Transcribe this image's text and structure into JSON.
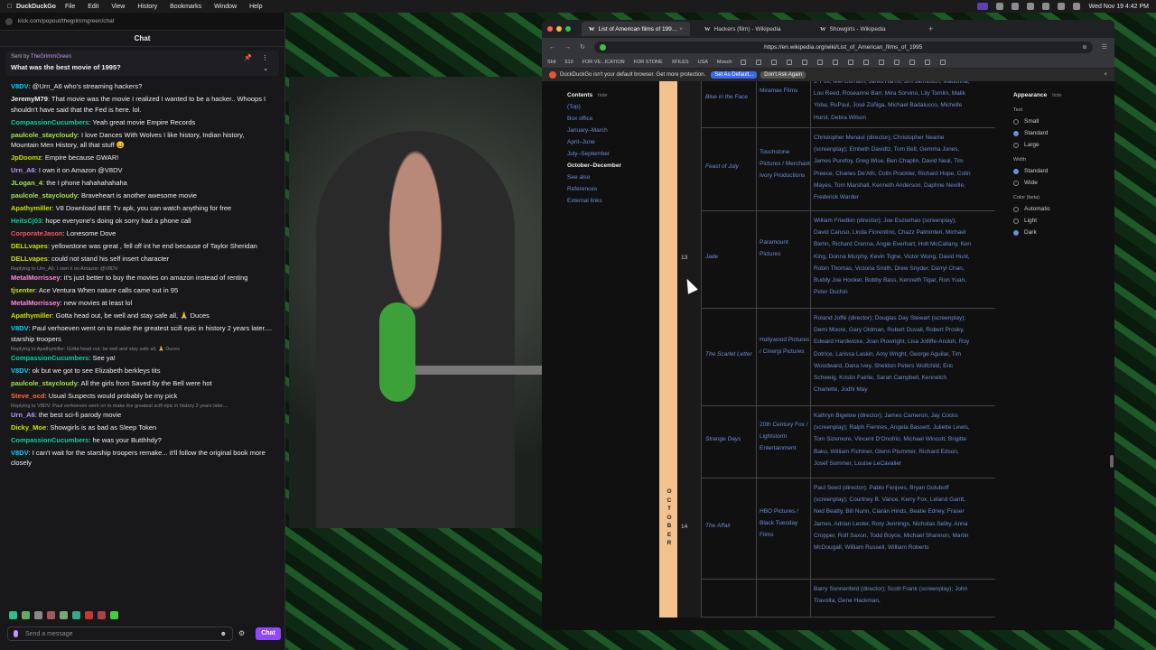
{
  "menubar": {
    "app": "DuckDuckGo",
    "items": [
      "File",
      "Edit",
      "View",
      "History",
      "Bookmarks",
      "Window",
      "Help"
    ],
    "clock": "Wed Nov 19 4:42 PM"
  },
  "chat": {
    "url": "kick.com/popout/thegrimmgreen/chat",
    "title": "Chat",
    "pinned": {
      "sent_prefix": "Sent by",
      "sent_by": "TheGrimmGreen",
      "question": "What was the best movie of 1995?"
    },
    "messages": [
      {
        "user": "V8DV",
        "color": "#00d4ff",
        "text": "@Urn_A6 who's streaming hackers?"
      },
      {
        "user": "JeremyM79",
        "color": "#efeff1",
        "text": "That movie was the movie I realized I wanted to be a hacker.. Whoops I shouldn't have said that the Fed is here. lol."
      },
      {
        "user": "CompassionCucumbers",
        "color": "#00d4a0",
        "text": "Yeah great movie Empire Records"
      },
      {
        "user": "paulcole_staycloudy",
        "color": "#a0e050",
        "text": "I love Dances With Wolves I like history, Indian history, Mountain Men History, all that stuff 😀"
      },
      {
        "user": "JpDoomz",
        "color": "#c8e000",
        "text": "Empire because GWAR!"
      },
      {
        "user": "Urn_A6",
        "color": "#bf94ff",
        "text": "I own it on Amazon @V8DV"
      },
      {
        "user": "JLogan_4",
        "color": "#a0e050",
        "text": "the I phone hahahahahaha"
      },
      {
        "user": "paulcole_staycloudy",
        "color": "#a0e050",
        "text": "Braveheart is another awesome movie"
      },
      {
        "user": "Apathymiller",
        "color": "#c8e000",
        "text": "V8 Download BEE Tv apk, you can watch anything for free"
      },
      {
        "user": "HeitsCj03",
        "color": "#00d4a0",
        "text": "hope everyone's doing ok sorry had a phone call"
      },
      {
        "user": "CorporateJason",
        "color": "#ff4f6a",
        "text": "Lonesome Dove"
      },
      {
        "user": "DELLvapes",
        "color": "#c8e000",
        "text": "yellowstone was great , fell off int he end because of Taylor Sheridan"
      },
      {
        "user": "DELLvapes",
        "color": "#c8e000",
        "text": "could not stand his self insert character"
      },
      {
        "user": "MetalMorrissey",
        "color": "#ff8ad8",
        "reply": "Replying to Urn_A6: I own it on Amazon @V8DV",
        "text": "it's just better to buy the movies on amazon instead of renting"
      },
      {
        "user": "tjsenter",
        "color": "#c8e000",
        "text": "Ace Ventura When nature calls came out in 95"
      },
      {
        "user": "MetalMorrissey",
        "color": "#ff8ad8",
        "text": "new movies at least lol"
      },
      {
        "user": "Apathymiller",
        "color": "#c8e000",
        "text": "Gotta head out, be well and stay safe all, 🙏 Duces"
      },
      {
        "user": "V8DV",
        "color": "#00d4ff",
        "text": "Paul verhoeven went on to make the greatest scifi epic in history 2 years later.... starship troopers"
      },
      {
        "user": "CompassionCucumbers",
        "color": "#00d4a0",
        "reply": "Replying to Apathymiller: Gotta head out, be well and stay safe all, 🙏 Duces",
        "text": "See ya!"
      },
      {
        "user": "V8DV",
        "color": "#00d4ff",
        "text": "ok but we got to see Elizabeth berkleys tits"
      },
      {
        "user": "paulcole_staycloudy",
        "color": "#a0e050",
        "text": "All the girls from Saved by the Bell were hot"
      },
      {
        "user": "Steve_ocd",
        "color": "#ff6a3a",
        "text": "Usual Suspects would probably be my pick"
      },
      {
        "user": "Urn_A6",
        "color": "#bf94ff",
        "reply": "Replying to V8DV: Paul verhoeven went on to make the greatest scifi epic in history 2 years later....",
        "text": "the best sci-fi parody movie"
      },
      {
        "user": "Dicky_Moe",
        "color": "#c8e000",
        "text": "Showgirls is as bad as Sleep Token"
      },
      {
        "user": "CompassionCucumbers",
        "color": "#00d4a0",
        "text": "he was your Butthhdy?"
      },
      {
        "user": "V8DV",
        "color": "#00d4ff",
        "text": "I can't wait for the starship troopers remake... it'll follow the original book more closely"
      }
    ],
    "composer_placeholder": "Send a message",
    "send_label": "Chat"
  },
  "browser": {
    "tabs": [
      {
        "label": "List of American films of 199…",
        "active": true
      },
      {
        "label": "Hackers (film) - Wikipedia",
        "active": false
      },
      {
        "label": "Showgirls - Wikipedia",
        "active": false
      }
    ],
    "url": "https://en.wikipedia.org/wiki/List_of_American_films_of_1995",
    "bookmarks": [
      "Shit",
      "510",
      "FOR VE...ICATION",
      "FOR STONE",
      "XFILES",
      "USA",
      "Mooch"
    ],
    "ddg_banner": {
      "text": "DuckDuckGo isn't your default browser. Get more protection.",
      "set_default": "Set As Default...",
      "dont_ask": "Don't Ask Again"
    },
    "toc": {
      "heading": "Contents",
      "hide": "hide",
      "items": [
        "(Top)",
        "Box office",
        "January–March",
        "April–June",
        "July–September",
        "October–December",
        "See also",
        "References",
        "External links"
      ],
      "current": "October–December"
    },
    "appearance": {
      "heading": "Appearance",
      "hide": "hide",
      "text_label": "Text",
      "text_options": [
        "Small",
        "Standard",
        "Large"
      ],
      "text_selected": "Standard",
      "width_label": "Width",
      "width_options": [
        "Standard",
        "Wide"
      ],
      "width_selected": "Standard",
      "color_label": "Color (beta)",
      "color_options": [
        "Automatic",
        "Light",
        "Dark"
      ],
      "color_selected": "Dark"
    },
    "table": {
      "month": "OCTOBER",
      "rows": [
        {
          "day": "",
          "title": "Blue in the Face",
          "studio": "Miramax Films",
          "cast": "J. Fox, Mel Gorham, Jared Harris, Jim Jarmusch, Madonna, Lou Reed, Roseanne Barr, Mira Sorvino, Lily Tomlin, Malik Yoba, RuPaul, José Zúñiga, Michael Badalucco, Michelle Hurst, Debra Wilson"
        },
        {
          "day": "",
          "title": "Feast of July",
          "studio": "Touchstone Pictures / Merchant Ivory Productions",
          "cast": "Christopher Menaul (director); Christopher Neame (screenplay); Embeth Davidtz, Tom Bell, Gemma Jones, James Purefoy, Greg Wise, Ben Chaplin, David Neal, Tim Preece, Charles De'Ath, Colin Prockter, Richard Hope, Colin Mayes, Tom Marshall, Kenneth Anderson, Daphne Neville, Frederick Warder"
        },
        {
          "day": "13",
          "title": "Jade",
          "studio": "Paramount Pictures",
          "cast": "William Friedkin (director); Joe Eszterhas (screenplay); David Caruso, Linda Fiorentino, Chazz Palminteri, Michael Biehn, Richard Crenna, Angie Everhart, Holt McCallany, Ken King, Donna Murphy, Kevin Tighe, Victor Wong, David Hunt, Robin Thomas, Victoria Smith, Drew Snyder, Darryl Chan, Buddy Joe Hooker, Bobby Bass, Kenneth Tigar, Ron Yuan, Peter Duchin"
        },
        {
          "day": "",
          "title": "The Scarlet Letter",
          "studio": "Hollywood Pictures / Cinergi Pictures",
          "cast": "Roland Joffé (director); Douglas Day Stewart (screenplay); Demi Moore, Gary Oldman, Robert Duvall, Robert Prosky, Edward Hardwicke, Joan Plowright, Lisa Jolliffe-Andoh, Roy Dotrice, Larissa Laskin, Amy Wright, George Aguilar, Tim Woodward, Dana Ivey, Sheldon Peters Wolfchild, Eric Schweig, Kristin Fairlie, Sarah Campbell, Kennetch Charlette, Jodhi May"
        },
        {
          "day": "",
          "title": "Strange Days",
          "studio": "20th Century Fox / Lightstorm Entertainment",
          "cast": "Kathryn Bigelow (director); James Cameron, Jay Cocks (screenplay); Ralph Fiennes, Angela Bassett, Juliette Lewis, Tom Sizemore, Vincent D'Onofrio, Michael Wincott, Brigitte Bako, William Fichtner, Glenn Plummer, Richard Edson, Josef Sommer, Louise LeCavalier"
        },
        {
          "day": "14",
          "title": "The Affair",
          "studio": "HBO Pictures / Black Tuesday Films",
          "cast": "Paul Seed (director); Pablo Fenjves, Bryan Goluboff (screenplay); Courtney B. Vance, Kerry Fox, Leland Gantt, Ned Beatty, Bill Nunn, Ciarán Hinds, Beatie Edney, Fraser James, Adrian Lester, Rory Jennings, Nicholas Selby, Anna Cropper, Rolf Saxon, Todd Boyce, Michael Shannon, Martin McDougall, William Russell, William Roberts"
        },
        {
          "day": "",
          "title": "",
          "studio": "",
          "cast": "Barry Sonnenfeld (director); Scott Frank (screenplay); John Travolta, Gene Hackman,"
        }
      ]
    }
  }
}
